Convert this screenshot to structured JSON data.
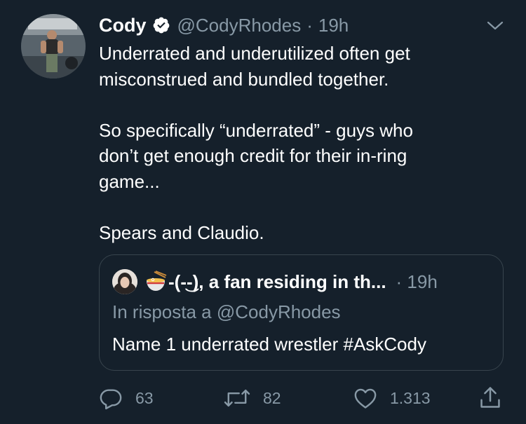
{
  "tweet": {
    "author_name": "Cody",
    "verified": true,
    "handle": "@CodyRhodes",
    "separator": "·",
    "time": "19h",
    "body": {
      "line1": "Underrated and underutilized often get",
      "line2": "misconstrued and bundled together.",
      "line3": "So specifically “underrated” - guys who",
      "line4": "don’t get enough credit for their in-ring",
      "line5": "game...",
      "line6": "Spears and Claudio."
    }
  },
  "quoted": {
    "author_name": "-(-͜-), a fan residing in th...",
    "time": "· 19h",
    "reply_prefix": "In risposta a @CodyRhodes",
    "text": "Name 1 underrated wrestler #AskCody"
  },
  "actions": {
    "replies": "63",
    "retweets": "82",
    "likes": "1.313"
  },
  "icons": {
    "verified": "verified-badge-icon",
    "caret": "chevron-down-icon",
    "reply": "reply-bubble-icon",
    "retweet": "retweet-icon",
    "like": "heart-icon",
    "share": "share-icon",
    "quoted_emoji": "ramen-bowl-emoji"
  },
  "colors": {
    "background": "#15202b",
    "text_primary": "#ffffff",
    "text_secondary": "#8899a6",
    "border": "#38444d"
  }
}
